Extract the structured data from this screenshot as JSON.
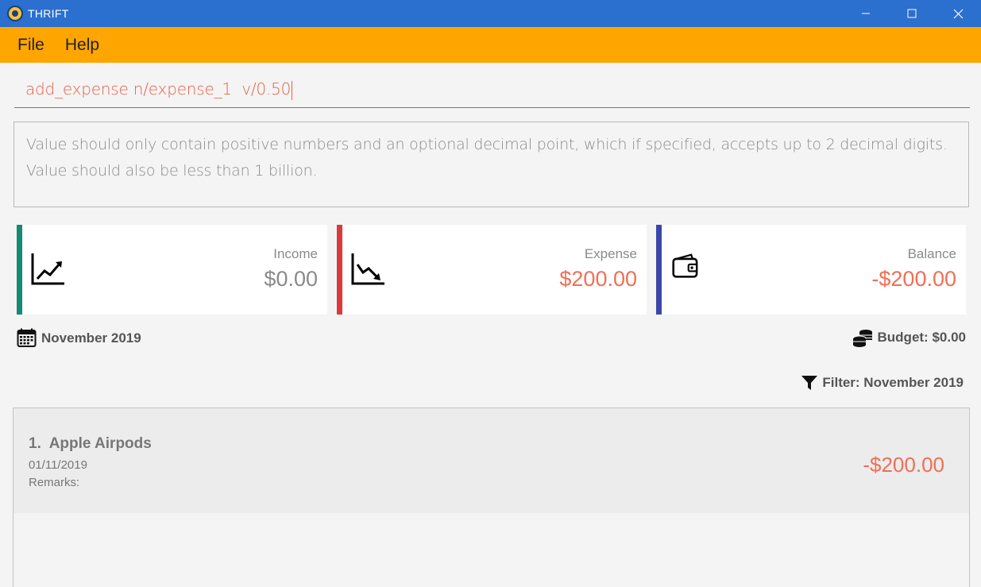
{
  "window": {
    "title": "THRIFT"
  },
  "menu": {
    "file": "File",
    "help": "Help"
  },
  "command_box": {
    "value": "add_expense n/expense_1  v/0.50"
  },
  "result_box": {
    "line1": "Value should only contain positive numbers and an optional decimal point, which if specified, accepts up to 2 decimal digits.",
    "line2": "Value should also be less than 1 billion."
  },
  "cards": {
    "income": {
      "label": "Income",
      "amount": "$0.00",
      "bar_color": "#138a72",
      "amount_color": "#8a8a8a",
      "icon": "trending-up-icon"
    },
    "expense": {
      "label": "Expense",
      "amount": "$200.00",
      "bar_color": "#d93b3b",
      "amount_color": "#ef6f55",
      "icon": "trending-down-icon"
    },
    "balance": {
      "label": "Balance",
      "amount": "-$200.00",
      "bar_color": "#3b47a8",
      "amount_color": "#ef6f55",
      "icon": "wallet-icon"
    }
  },
  "month": {
    "text": "November 2019",
    "icon": "calendar-icon"
  },
  "budget": {
    "text": "Budget: $0.00",
    "icon": "coins-icon"
  },
  "filter": {
    "text": "Filter: November 2019",
    "icon": "filter-icon"
  },
  "transactions": [
    {
      "title": "1.  Apple Airpods",
      "date": "01/11/2019",
      "remarks": "Remarks:",
      "amount": "-$200.00"
    }
  ],
  "colors": {
    "titlebar": "#2b6fcf",
    "menubar": "#ffa500",
    "negative": "#ef6f55"
  }
}
